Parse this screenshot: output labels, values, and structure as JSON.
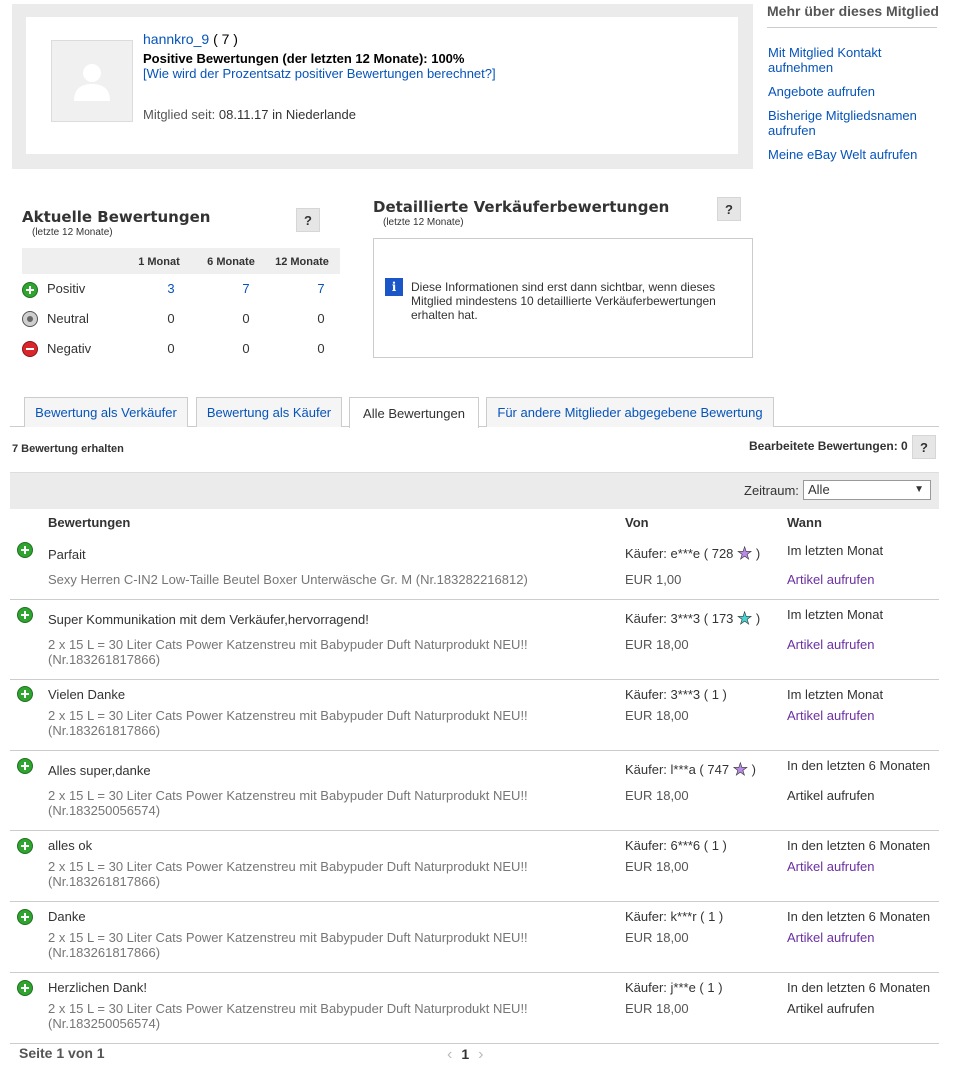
{
  "profile": {
    "username": "hannkro_9",
    "score": "( 7 )",
    "positive_label": "Positive Bewertungen (der letzten 12 Monate): 100%",
    "how_calc_link": "[Wie wird der Prozentsatz positiver Bewertungen berechnet?]",
    "member_since_label": "Mitglied seit:",
    "member_since_value": "08.11.17 in Niederlande"
  },
  "sidebar": {
    "title": "Mehr über dieses Mitglied",
    "links": [
      "Mit Mitglied Kontakt aufnehmen",
      "Angebote aufrufen",
      "Bisherige Mitgliedsnamen aufrufen",
      "Meine eBay Welt aufrufen"
    ]
  },
  "current": {
    "title": "Aktuelle Bewertungen",
    "subtitle": "(letzte 12 Monate)",
    "help": "?",
    "columns": [
      "1 Monat",
      "6 Monate",
      "12 Monate"
    ],
    "rows": [
      {
        "label": "Positiv",
        "icon": "positive-icon",
        "values": [
          "3",
          "7",
          "7"
        ]
      },
      {
        "label": "Neutral",
        "icon": "neutral-icon",
        "values": [
          "0",
          "0",
          "0"
        ]
      },
      {
        "label": "Negativ",
        "icon": "negative-icon",
        "values": [
          "0",
          "0",
          "0"
        ]
      }
    ]
  },
  "detailed": {
    "title": "Detaillierte Verkäuferbewertungen",
    "subtitle": "(letzte 12 Monate)",
    "help": "?",
    "info_icon": "i",
    "info": "Diese Informationen sind erst dann sichtbar, wenn dieses Mitglied mindestens 10 detaillierte Verkäuferbewertungen erhalten hat."
  },
  "tabs": [
    "Bewertung als Verkäufer",
    "Bewertung als Käufer",
    "Alle Bewertungen",
    "Für andere Mitglieder abgegebene Bewertung"
  ],
  "active_tab": "Alle Bewertungen",
  "received": "7 Bewertung erhalten",
  "edited": "Bearbeitete Bewertungen: 0",
  "edited_help": "?",
  "filter": {
    "label": "Zeitraum:",
    "value": "Alle"
  },
  "table": {
    "headers": [
      "Bewertungen",
      "Von",
      "Wann"
    ],
    "rows": [
      {
        "comment": "Parfait",
        "item": "Sexy Herren C-IN2 Low-Taille Beutel Boxer Unterwäsche Gr. M (Nr.183282216812)",
        "buyer": "Käufer: e***e ( 728",
        "star": "purple",
        "close": " )",
        "price": "EUR 1,00",
        "when": "Im letzten Monat",
        "link": "Artikel aufrufen"
      },
      {
        "comment": "Super Kommunikation mit dem Verkäufer,hervorragend!",
        "item": "2 x 15 L = 30 Liter Cats Power Katzenstreu mit Babypuder Duft Naturprodukt NEU!! (Nr.183261817866)",
        "buyer": "Käufer: 3***3 ( 173",
        "star": "turquoise",
        "close": " )",
        "price": "EUR 18,00",
        "when": "Im letzten Monat",
        "link": "Artikel aufrufen"
      },
      {
        "comment": "Vielen Danke",
        "item": "2 x 15 L = 30 Liter Cats Power Katzenstreu mit Babypuder Duft Naturprodukt NEU!! (Nr.183261817866)",
        "buyer": "Käufer: 3***3 ( 1 )",
        "star": "",
        "close": "",
        "price": "EUR 18,00",
        "when": "Im letzten Monat",
        "link": "Artikel aufrufen"
      },
      {
        "comment": "Alles super,danke",
        "item": "2 x 15 L = 30 Liter Cats Power Katzenstreu mit Babypuder Duft Naturprodukt NEU!! (Nr.183250056574)",
        "buyer": "Käufer: l***a ( 747",
        "star": "purple",
        "close": " )",
        "price": "EUR 18,00",
        "when": "In den letzten 6 Monaten",
        "link": "Artikel aufrufen"
      },
      {
        "comment": "alles ok",
        "item": "2 x 15 L = 30 Liter Cats Power Katzenstreu mit Babypuder Duft Naturprodukt NEU!! (Nr.183261817866)",
        "buyer": "Käufer: 6***6 ( 1 )",
        "star": "",
        "close": "",
        "price": "EUR 18,00",
        "when": "In den letzten 6 Monaten",
        "link": "Artikel aufrufen"
      },
      {
        "comment": "Danke",
        "item": "2 x 15 L = 30 Liter Cats Power Katzenstreu mit Babypuder Duft Naturprodukt NEU!! (Nr.183261817866)",
        "buyer": "Käufer: k***r ( 1 )",
        "star": "",
        "close": "",
        "price": "EUR 18,00",
        "when": "In den letzten 6 Monaten",
        "link": "Artikel aufrufen"
      },
      {
        "comment": "Herzlichen Dank!",
        "item": "2 x 15 L = 30 Liter Cats Power Katzenstreu mit Babypuder Duft Naturprodukt NEU!! (Nr.183250056574)",
        "buyer": "Käufer: j***e ( 1 )",
        "star": "",
        "close": "",
        "price": "EUR 18,00",
        "when": "In den letzten 6 Monaten",
        "link": "Artikel aufrufen"
      }
    ]
  },
  "pagination": {
    "info": "Seite 1 von 1",
    "current": "1",
    "prev": "‹",
    "next": "›"
  },
  "colors": {
    "link": "#0654ba",
    "visited": "#6b2fa3",
    "positive": "#2ea52e",
    "negative": "#d9262c",
    "star_purple": "#b98ae6",
    "star_turquoise": "#47d3d3"
  }
}
